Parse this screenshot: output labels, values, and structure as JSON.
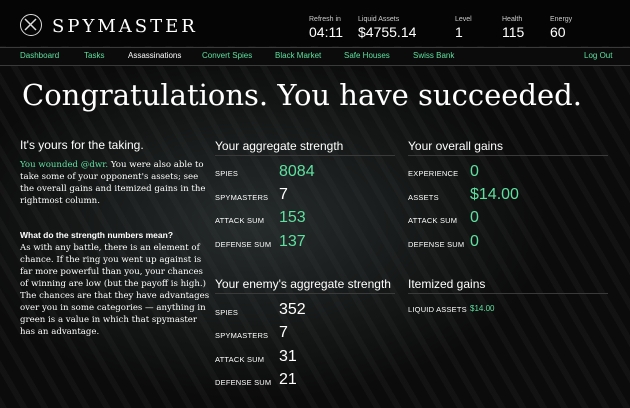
{
  "app": {
    "brand": "SPYMASTER"
  },
  "stats": [
    {
      "label": "Refresh in",
      "value": "04:11"
    },
    {
      "label": "Liquid Assets",
      "value": "$4755.14"
    },
    {
      "label": "Level",
      "value": "1"
    },
    {
      "label": "Health",
      "value": "115"
    },
    {
      "label": "Energy",
      "value": "60"
    }
  ],
  "nav": {
    "items": [
      "Dashboard",
      "Tasks",
      "Assassinations",
      "Convert Spies",
      "Black Market",
      "Safe Houses",
      "Swiss Bank"
    ],
    "logout": "Log Out"
  },
  "title": "Congratulations. You have succeeded.",
  "intro": {
    "heading": "It's yours for the taking.",
    "p1_green": "You wounded @dwr.",
    "p1_rest": " You were also able to take some of your opponent's assets; see the overall gains and itemized gains in the rightmost column.",
    "subhead": "What do the strength numbers mean?",
    "p2": "As with any battle, there is an element of chance. If the ring you went up against is far more powerful than you, your chances of winning are low (but the payoff is high.) The chances are that they have advantages over you in some categories — anything in green is a value in which that spymaster has an advantage."
  },
  "aggregate": {
    "title": "Your aggregate strength",
    "rows": [
      {
        "label": "SPIES",
        "value": "8084"
      },
      {
        "label": "SPYMASTERS",
        "value": "7"
      },
      {
        "label": "ATTACK SUM",
        "value": "153"
      },
      {
        "label": "DEFENSE SUM",
        "value": "137"
      }
    ]
  },
  "enemy": {
    "title": "Your enemy's aggregate strength",
    "rows": [
      {
        "label": "SPIES",
        "value": "352"
      },
      {
        "label": "SPYMASTERS",
        "value": "7"
      },
      {
        "label": "ATTACK SUM",
        "value": "31"
      },
      {
        "label": "DEFENSE SUM",
        "value": "21"
      }
    ]
  },
  "gains": {
    "title": "Your overall gains",
    "rows": [
      {
        "label": "EXPERIENCE",
        "value": "0"
      },
      {
        "label": "ASSETS",
        "value": "$14.00"
      },
      {
        "label": "ATTACK SUM",
        "value": "0"
      },
      {
        "label": "DEFENSE SUM",
        "value": "0"
      }
    ]
  },
  "itemized": {
    "title": "Itemized gains",
    "rows": [
      {
        "label": "LIQUID ASSETS",
        "value": "$14.00"
      }
    ]
  },
  "colors": {
    "accent": "#5ee0a0",
    "text": "#ffffff",
    "background": "#0a0a0a"
  }
}
